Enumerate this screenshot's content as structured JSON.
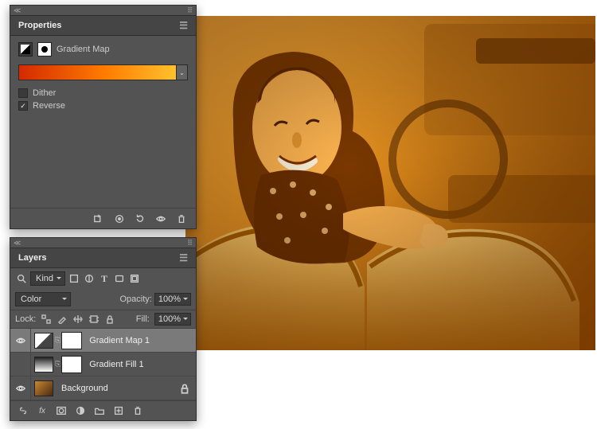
{
  "properties": {
    "title": "Properties",
    "adjustment_type": "Gradient Map",
    "dither_label": "Dither",
    "dither_checked": false,
    "reverse_label": "Reverse",
    "reverse_checked": true,
    "gradient_stops": [
      "#d42a00",
      "#ff7a00",
      "#ffcc33"
    ]
  },
  "layers": {
    "title": "Layers",
    "filter_label": "Kind",
    "blend_mode": "Color",
    "opacity_label": "Opacity:",
    "opacity_value": "100%",
    "lock_label": "Lock:",
    "fill_label": "Fill:",
    "fill_value": "100%",
    "items": [
      {
        "name": "Gradient Map 1",
        "selected": true,
        "visible": true,
        "type": "adj"
      },
      {
        "name": "Gradient Fill 1",
        "selected": false,
        "visible": false,
        "type": "grdfill"
      },
      {
        "name": "Background",
        "selected": false,
        "visible": true,
        "type": "bg"
      }
    ]
  }
}
